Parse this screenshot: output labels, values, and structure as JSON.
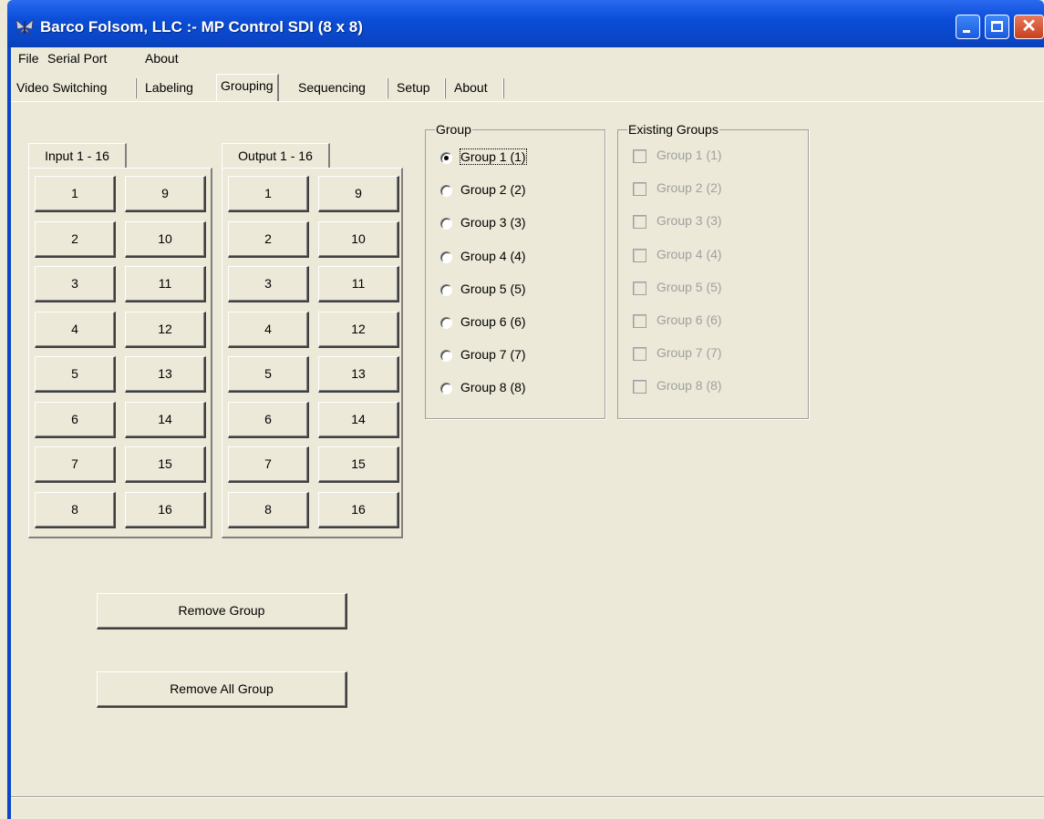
{
  "window": {
    "title": "Barco Folsom, LLC :- MP Control SDI (8 x 8)",
    "app_icon": "butterfly-logo-icon",
    "close_glyph": "✕"
  },
  "menu": [
    "File",
    "Serial Port",
    "About"
  ],
  "tabs": [
    "Video Switching",
    "Labeling",
    "Grouping",
    "Sequencing",
    "Setup",
    "About"
  ],
  "active_tab": "Grouping",
  "input_panel": {
    "tab_label": "Input 1 - 16",
    "buttons": [
      "1",
      "2",
      "3",
      "4",
      "5",
      "6",
      "7",
      "8",
      "9",
      "10",
      "11",
      "12",
      "13",
      "14",
      "15",
      "16"
    ]
  },
  "output_panel": {
    "tab_label": "Output 1 - 16",
    "buttons": [
      "1",
      "2",
      "3",
      "4",
      "5",
      "6",
      "7",
      "8",
      "9",
      "10",
      "11",
      "12",
      "13",
      "14",
      "15",
      "16"
    ]
  },
  "group_box": {
    "title": "Group",
    "options": [
      "Group 1 (1)",
      "Group 2 (2)",
      "Group 3 (3)",
      "Group 4 (4)",
      "Group 5 (5)",
      "Group 6 (6)",
      "Group 7 (7)",
      "Group 8 (8)"
    ],
    "selected": "Group 1 (1)"
  },
  "existing_groups": {
    "title": "Existing Groups",
    "items": [
      "Group 1 (1)",
      "Group 2 (2)",
      "Group 3 (3)",
      "Group 4 (4)",
      "Group 5 (5)",
      "Group 6 (6)",
      "Group 7 (7)",
      "Group 8 (8)"
    ]
  },
  "actions": {
    "remove_group": "Remove Group",
    "remove_all_group": "Remove All Group"
  },
  "colors": {
    "titlebar": "#0a46c8",
    "face": "#ece9d8",
    "disabled_text": "#a0a0a0"
  }
}
